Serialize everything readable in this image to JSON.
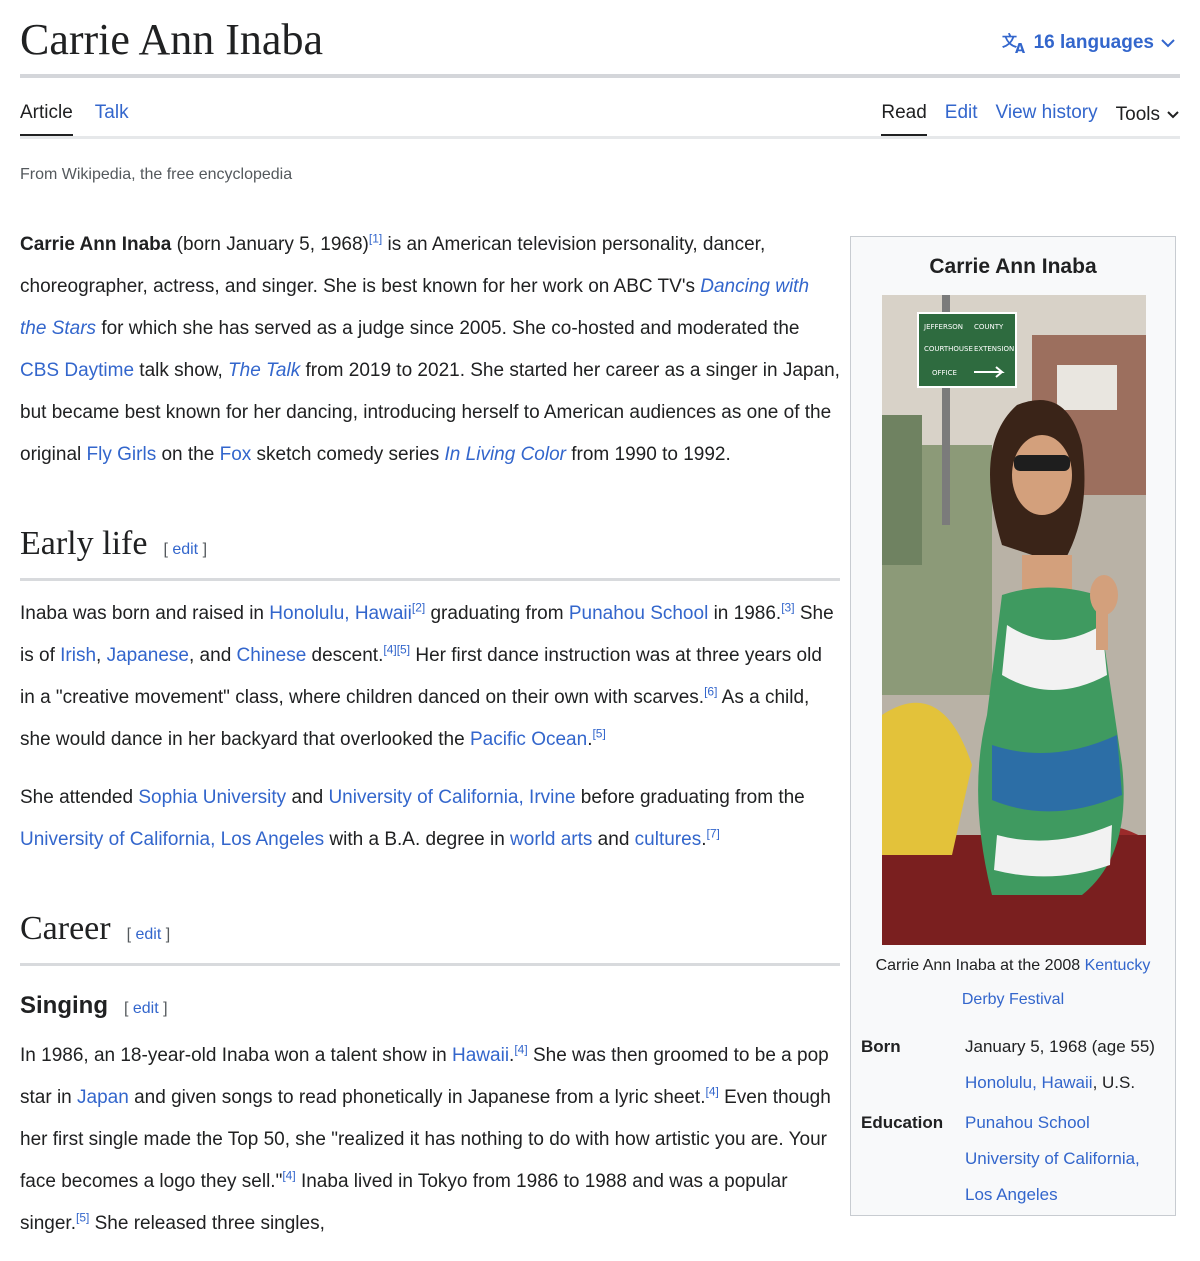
{
  "header": {
    "title": "Carrie Ann Inaba",
    "languages_label": "16 languages",
    "tabs_left": [
      "Article",
      "Talk"
    ],
    "tabs_right": [
      "Read",
      "Edit",
      "View history"
    ],
    "tools_label": "Tools",
    "tagline": "From Wikipedia, the free encyclopedia"
  },
  "intro": {
    "p1_bold": "Carrie Ann Inaba",
    "p1_a": " (born January 5, 1968)",
    "ref1": "[1]",
    "p1_b": " is an American television personality, dancer, choreographer, actress, and singer. She is best known for her work on ABC TV's ",
    "link_dwts": "Dancing with the Stars",
    "p1_c": " for which she has served as a judge since 2005. She co-hosted and moderated the ",
    "link_cbs": "CBS Daytime",
    "p1_d": " talk show, ",
    "link_talk": "The Talk",
    "p1_e": " from 2019 to 2021. She started her career as a singer in Japan, but became best known for her dancing, introducing herself to American audiences as one of the original ",
    "link_flygirls": "Fly Girls",
    "p1_f": " on the ",
    "link_fox": "Fox",
    "p1_g": " sketch comedy series ",
    "link_ilc": "In Living Color",
    "p1_h": " from 1990 to 1992."
  },
  "early_life": {
    "heading": "Early life",
    "edit": "edit",
    "p1_a": "Inaba was born and raised in ",
    "link_honolulu": "Honolulu, Hawaii",
    "ref2": "[2]",
    "p1_b": " graduating from ",
    "link_punahou": "Punahou School",
    "p1_c": " in 1986.",
    "ref3": "[3]",
    "p1_d": " She is of ",
    "link_irish": "Irish",
    "p1_e": ", ",
    "link_japanese": "Japanese",
    "p1_f": ", and ",
    "link_chinese": "Chinese",
    "p1_g": " descent.",
    "ref45": "[4][5]",
    "p1_h": " Her first dance instruction was at three years old in a \"creative movement\" class, where children danced on their own with scarves.",
    "ref6": "[6]",
    "p1_i": " As a child, she would dance in her backyard that overlooked the ",
    "link_pacific": "Pacific Ocean",
    "p1_j": ".",
    "ref5": "[5]",
    "p2_a": "She attended ",
    "link_sophia": "Sophia University",
    "p2_b": " and ",
    "link_uci": "University of California, Irvine",
    "p2_c": " before graduating from the ",
    "link_ucla": "University of California, Los Angeles",
    "p2_d": " with a B.A. degree in ",
    "link_worldarts": "world arts",
    "p2_e": " and ",
    "link_cultures": "cultures",
    "p2_f": ".",
    "ref7": "[7]"
  },
  "career": {
    "heading": "Career",
    "edit": "edit",
    "singing_heading": "Singing",
    "singing_edit": "edit",
    "p1_a": "In 1986, an 18-year-old Inaba won a talent show in ",
    "link_hawaii": "Hawaii",
    "p1_b": ".",
    "ref4a": "[4]",
    "p1_c": " She was then groomed to be a pop star in ",
    "link_japan": "Japan",
    "p1_d": " and given songs to read phonetically in Japanese from a lyric sheet.",
    "ref4b": "[4]",
    "p1_e": " Even though her first single made the Top 50, she \"realized it has nothing to do with how artistic you are. Your face becomes a logo they sell.\"",
    "ref4c": "[4]",
    "p1_f": " Inaba lived in Tokyo from 1986 to 1988 and was a popular singer.",
    "ref5b": "[5]",
    "p1_g": " She released three singles,"
  },
  "infobox": {
    "title": "Carrie Ann Inaba",
    "sign_text_1": "JEFFERSON",
    "sign_text_2": "COUNTY",
    "sign_text_3": "COURTHOUSE",
    "sign_text_4": "EXTENSION",
    "sign_text_5": "OFFICE",
    "caption_a": "Carrie Ann Inaba at the 2008 ",
    "caption_link": "Kentucky Derby Festival",
    "born_label": "Born",
    "born_value": "January 5, 1968 (age 55)",
    "born_place_link": "Honolulu, Hawaii",
    "born_place_suffix": ", U.S.",
    "education_label": "Education",
    "education_1": "Punahou School",
    "education_2": "University of California, Los Angeles"
  },
  "colors": {
    "link": "#3366cc",
    "text": "#202122",
    "muted": "#54595d",
    "infobox_bg": "#f8f9fa"
  }
}
